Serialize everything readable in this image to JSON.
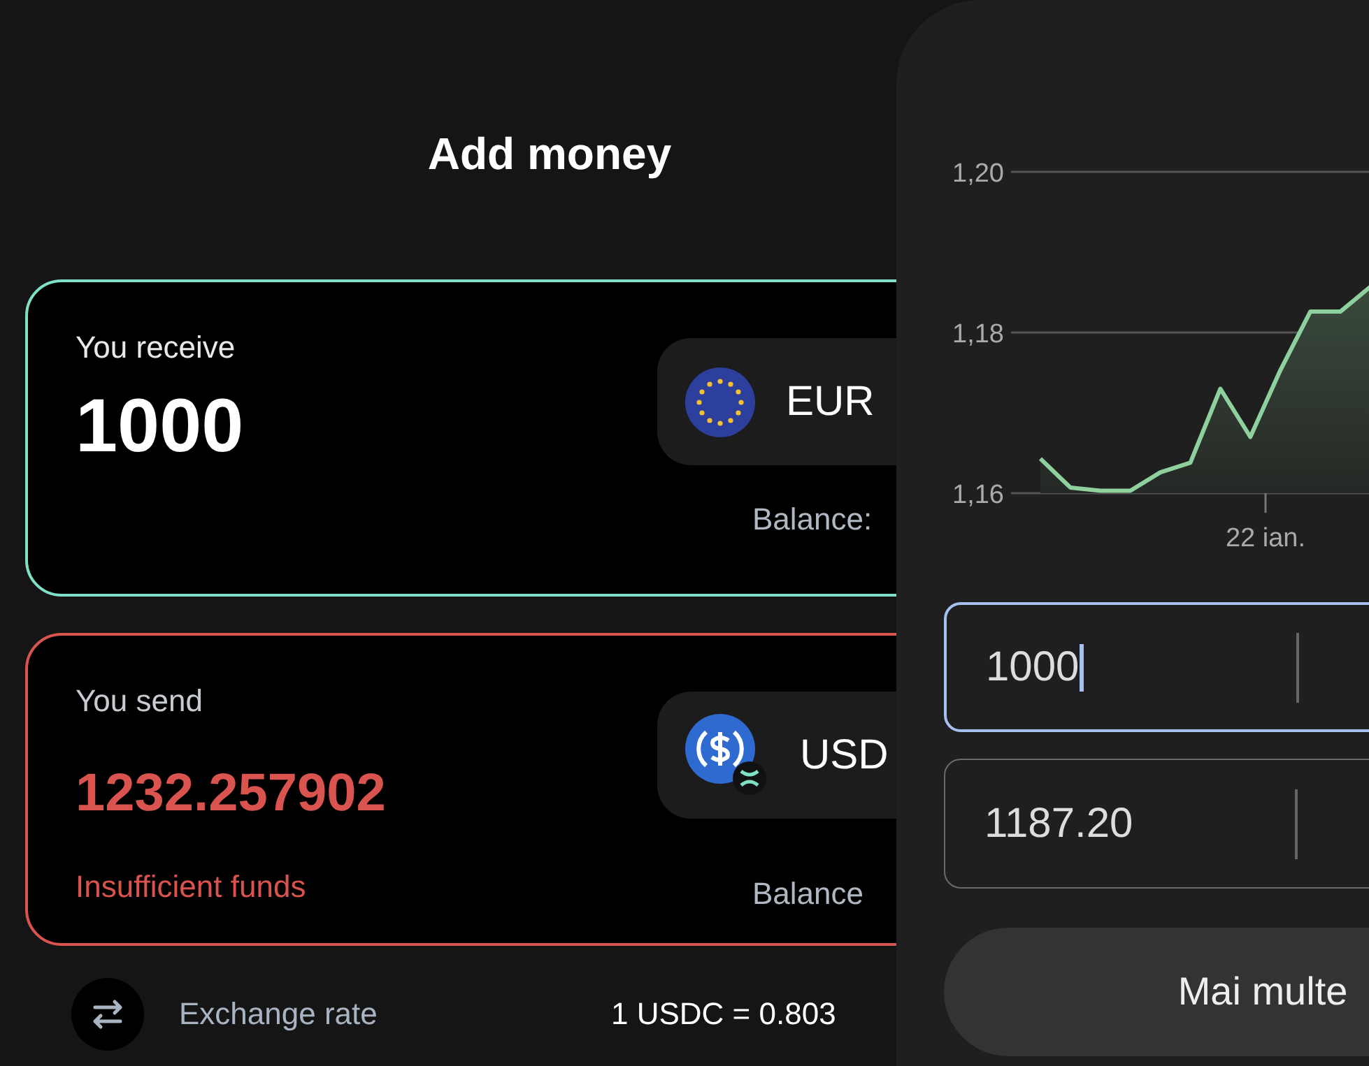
{
  "title": "Add money",
  "receive": {
    "label": "You receive",
    "amount": "1000",
    "currency": "EUR",
    "balance_label": "Balance:"
  },
  "send": {
    "label": "You send",
    "amount": "1232.257902",
    "error": "Insufficient funds",
    "currency": "USD",
    "balance_label": "Balance"
  },
  "details": [
    {
      "label": "Exchange rate",
      "value": "1 USDC = 0.803"
    }
  ],
  "converter": {
    "chart_data": {
      "type": "area",
      "series": [
        {
          "color": "#8fd19e",
          "values": [
            1.1643,
            1.1607,
            1.1603,
            1.1603,
            1.1626,
            1.1638,
            1.173,
            1.167,
            1.1753,
            1.1826,
            1.1826,
            1.1857
          ]
        }
      ],
      "ylim": [
        1.16,
        1.2
      ],
      "yticks": [
        {
          "value": 1.16,
          "label": "1,16"
        },
        {
          "value": 1.18,
          "label": "1,18"
        },
        {
          "value": 1.2,
          "label": "1,20"
        }
      ]
    },
    "date_label": "22 ian.",
    "fields": [
      {
        "value": "1000",
        "focused": true
      },
      {
        "value": "1187.20",
        "focused": false
      }
    ],
    "button": "Mai multe"
  }
}
